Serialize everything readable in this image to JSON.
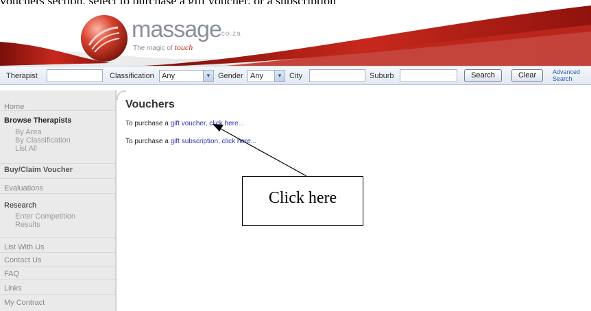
{
  "top_caption": "vouchers section, select to purchase a gift voucher, or a subscription",
  "logo": {
    "name": "massage",
    "domain": ".co.za",
    "tagline_prefix": "The magic of",
    "tagline_emphasis": "touch"
  },
  "search": {
    "therapist_label": "Therapist",
    "therapist_value": "",
    "classification_label": "Classification",
    "classification_value": "Any",
    "gender_label": "Gender",
    "gender_value": "Any",
    "city_label": "City",
    "city_value": "",
    "suburb_label": "Suburb",
    "suburb_value": "",
    "search_button": "Search",
    "clear_button": "Clear",
    "advanced_line1": "Advanced",
    "advanced_line2": "Search"
  },
  "sidebar": {
    "home": "Home",
    "browse": "Browse Therapists",
    "browse_sub": [
      "By Area",
      "By Classification",
      "List All"
    ],
    "voucher": "Buy/Claim Voucher",
    "evaluations": "Evaluations",
    "research": "Research",
    "research_sub": [
      "Enter Competition",
      "Results"
    ],
    "list_with_us": "List With Us",
    "contact": "Contact Us",
    "faq": "FAQ",
    "links": "Links",
    "contract": "My Contract"
  },
  "main": {
    "title": "Vouchers",
    "line1_prefix": "To purchase a",
    "line1_link": "gift voucher, click here...",
    "line2_prefix": "To purchase a",
    "line2_link": "gift subscription, click here..."
  },
  "annotation": {
    "label": "Click here"
  },
  "colors": {
    "banner_red": "#b8201a",
    "link_blue": "#2d2db8",
    "sidebar_bg": "#eaeaea"
  }
}
